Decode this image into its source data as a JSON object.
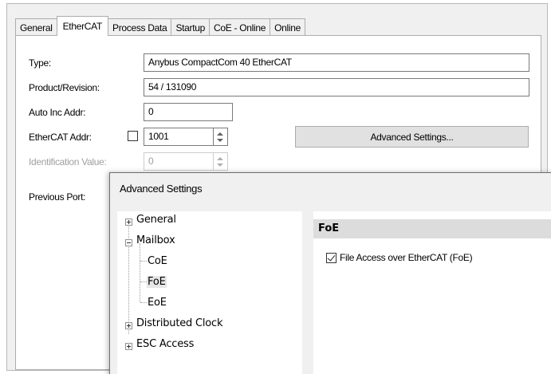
{
  "tabs": [
    "General",
    "EtherCAT",
    "Process Data",
    "Startup",
    "CoE - Online",
    "Online"
  ],
  "active_tab": "EtherCAT",
  "form": {
    "type_label": "Type:",
    "type_value": "Anybus CompactCom 40 EtherCAT",
    "product_label": "Product/Revision:",
    "product_value": "54 / 131090",
    "autoinc_label": "Auto Inc Addr:",
    "autoinc_value": "0",
    "ethercat_addr_label": "EtherCAT Addr:",
    "ethercat_addr_value": "1001",
    "ethercat_addr_checked": false,
    "advanced_button": "Advanced Settings...",
    "identification_label": "Identification Value:",
    "identification_value": "0",
    "previous_port_label": "Previous Port:"
  },
  "dialog": {
    "title": "Advanced Settings",
    "tree": {
      "general": "General",
      "mailbox": "Mailbox",
      "coe": "CoE",
      "foe": "FoE",
      "eoe": "EoE",
      "distributed_clock": "Distributed Clock",
      "esc_access": "ESC Access"
    },
    "selected_node": "FoE",
    "panel_header": "FoE",
    "foe_checkbox_label": "File Access over EtherCAT (FoE)",
    "foe_checkbox_checked": true
  }
}
